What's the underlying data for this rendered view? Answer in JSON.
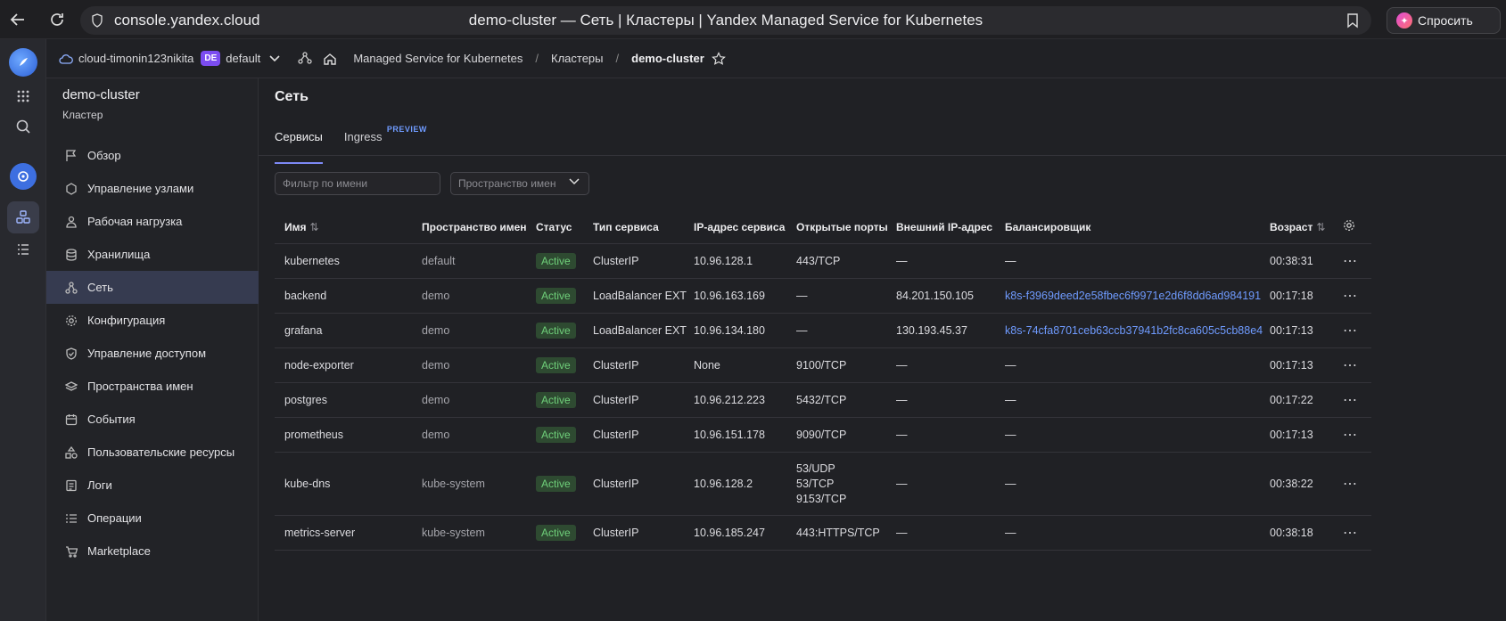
{
  "browser": {
    "url": "console.yandex.cloud",
    "page_title": "demo-cluster — Сеть | Кластеры | Yandex Managed Service for Kubernetes",
    "ask_label": "Спросить"
  },
  "breadcrumb": {
    "cloud": "cloud-timonin123nikita",
    "folder_badge": "DE",
    "folder": "default",
    "service": "Managed Service for Kubernetes",
    "section": "Кластеры",
    "current": "demo-cluster"
  },
  "sidebar": {
    "title": "demo-cluster",
    "subtitle": "Кластер",
    "items": [
      {
        "label": "Обзор",
        "icon": "flag-icon"
      },
      {
        "label": "Управление узлами",
        "icon": "nodes-icon"
      },
      {
        "label": "Рабочая нагрузка",
        "icon": "workload-icon"
      },
      {
        "label": "Хранилища",
        "icon": "database-icon"
      },
      {
        "label": "Сеть",
        "icon": "network-icon"
      },
      {
        "label": "Конфигурация",
        "icon": "gear-icon"
      },
      {
        "label": "Управление доступом",
        "icon": "shield-icon"
      },
      {
        "label": "Пространства имен",
        "icon": "layers-icon"
      },
      {
        "label": "События",
        "icon": "calendar-icon"
      },
      {
        "label": "Пользовательские ресурсы",
        "icon": "shapes-icon"
      },
      {
        "label": "Логи",
        "icon": "logs-icon"
      },
      {
        "label": "Операции",
        "icon": "list-icon"
      },
      {
        "label": "Marketplace",
        "icon": "cart-icon"
      }
    ]
  },
  "main": {
    "title": "Сеть",
    "tabs": [
      {
        "label": "Сервисы"
      },
      {
        "label": "Ingress",
        "badge": "PREVIEW"
      }
    ],
    "filter_placeholder": "Фильтр по имени",
    "namespace_placeholder": "Пространство имен"
  },
  "table": {
    "headers": {
      "name": "Имя",
      "namespace": "Пространство имен",
      "status": "Статус",
      "type": "Тип сервиса",
      "ip": "IP-адрес сервиса",
      "ports": "Открытые порты",
      "external_ip": "Внешний IP-адрес",
      "balancer": "Балансировщик",
      "age": "Возраст"
    },
    "rows": [
      {
        "name": "kubernetes",
        "namespace": "default",
        "status": "Active",
        "type": "ClusterIP",
        "ip": "10.96.128.1",
        "ports": [
          "443/TCP"
        ],
        "external_ip": "—",
        "balancer": "—",
        "age": "00:38:31"
      },
      {
        "name": "backend",
        "namespace": "demo",
        "status": "Active",
        "type": "LoadBalancer EXT",
        "ip": "10.96.163.169",
        "ports": [
          "—"
        ],
        "external_ip": "84.201.150.105",
        "balancer": "k8s-f3969deed2e58fbec6f9971e2d6f8dd6ad984191",
        "age": "00:17:18"
      },
      {
        "name": "grafana",
        "namespace": "demo",
        "status": "Active",
        "type": "LoadBalancer EXT",
        "ip": "10.96.134.180",
        "ports": [
          "—"
        ],
        "external_ip": "130.193.45.37",
        "balancer": "k8s-74cfa8701ceb63ccb37941b2fc8ca605c5cb88e4",
        "age": "00:17:13"
      },
      {
        "name": "node-exporter",
        "namespace": "demo",
        "status": "Active",
        "type": "ClusterIP",
        "ip": "None",
        "ports": [
          "9100/TCP"
        ],
        "external_ip": "—",
        "balancer": "—",
        "age": "00:17:13"
      },
      {
        "name": "postgres",
        "namespace": "demo",
        "status": "Active",
        "type": "ClusterIP",
        "ip": "10.96.212.223",
        "ports": [
          "5432/TCP"
        ],
        "external_ip": "—",
        "balancer": "—",
        "age": "00:17:22"
      },
      {
        "name": "prometheus",
        "namespace": "demo",
        "status": "Active",
        "type": "ClusterIP",
        "ip": "10.96.151.178",
        "ports": [
          "9090/TCP"
        ],
        "external_ip": "—",
        "balancer": "—",
        "age": "00:17:13"
      },
      {
        "name": "kube-dns",
        "namespace": "kube-system",
        "status": "Active",
        "type": "ClusterIP",
        "ip": "10.96.128.2",
        "ports": [
          "53/UDP",
          "53/TCP",
          "9153/TCP"
        ],
        "external_ip": "—",
        "balancer": "—",
        "age": "00:38:22"
      },
      {
        "name": "metrics-server",
        "namespace": "kube-system",
        "status": "Active",
        "type": "ClusterIP",
        "ip": "10.96.185.247",
        "ports": [
          "443:HTTPS/TCP"
        ],
        "external_ip": "—",
        "balancer": "—",
        "age": "00:38:18"
      }
    ]
  }
}
